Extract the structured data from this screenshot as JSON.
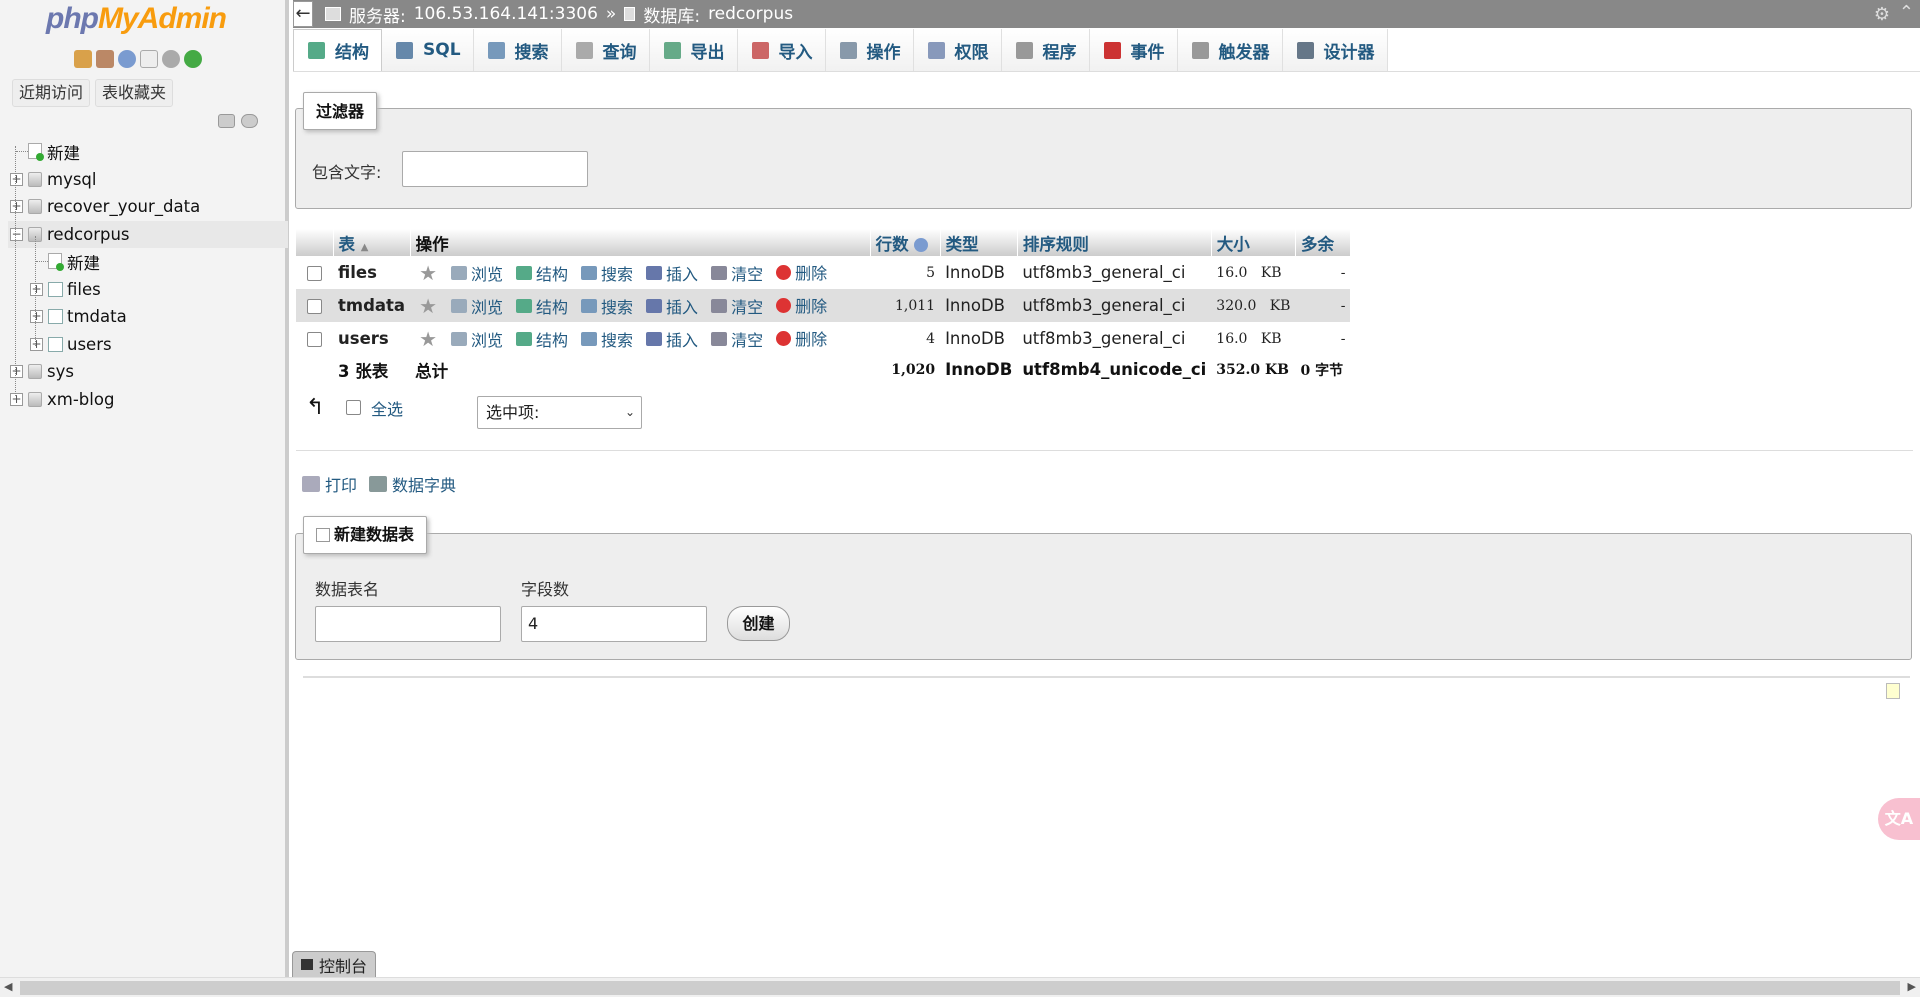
{
  "logo": {
    "part1": "php",
    "part2": "MyAdmin"
  },
  "sidebar": {
    "recent_tabs": [
      "近期访问",
      "表收藏夹"
    ],
    "tree": [
      {
        "label": "新建",
        "type": "new",
        "level": 0
      },
      {
        "label": "mysql",
        "type": "db",
        "level": 0
      },
      {
        "label": "recover_your_data",
        "type": "db",
        "level": 0
      },
      {
        "label": "redcorpus",
        "type": "db",
        "level": 0,
        "expanded": true
      },
      {
        "label": "新建",
        "type": "new",
        "level": 1
      },
      {
        "label": "files",
        "type": "table",
        "level": 1
      },
      {
        "label": "tmdata",
        "type": "table",
        "level": 1
      },
      {
        "label": "users",
        "type": "table",
        "level": 1
      },
      {
        "label": "sys",
        "type": "db",
        "level": 0
      },
      {
        "label": "xm-blog",
        "type": "db",
        "level": 0
      }
    ]
  },
  "topbar": {
    "server_label": "服务器:",
    "server": "106.53.164.141:3306",
    "sep": "»",
    "db_label": "数据库:",
    "db": "redcorpus"
  },
  "tabs": [
    {
      "label": "结构",
      "icon": "structure-icon",
      "color": "#5a8"
    },
    {
      "label": "SQL",
      "icon": "sql-icon",
      "color": "#68a"
    },
    {
      "label": "搜索",
      "icon": "search-icon",
      "color": "#79b"
    },
    {
      "label": "查询",
      "icon": "query-icon",
      "color": "#aaa"
    },
    {
      "label": "导出",
      "icon": "export-icon",
      "color": "#6a8"
    },
    {
      "label": "导入",
      "icon": "import-icon",
      "color": "#c66"
    },
    {
      "label": "操作",
      "icon": "wrench-icon",
      "color": "#89a"
    },
    {
      "label": "权限",
      "icon": "privileges-icon",
      "color": "#89b"
    },
    {
      "label": "程序",
      "icon": "routines-icon",
      "color": "#999"
    },
    {
      "label": "事件",
      "icon": "events-icon",
      "color": "#c33"
    },
    {
      "label": "触发器",
      "icon": "triggers-icon",
      "color": "#999"
    },
    {
      "label": "设计器",
      "icon": "designer-icon",
      "color": "#678"
    }
  ],
  "filter": {
    "legend": "过滤器",
    "label": "包含文字:",
    "value": ""
  },
  "table": {
    "headers": {
      "table": "表",
      "action": "操作",
      "rows": "行数",
      "type": "类型",
      "collation": "排序规则",
      "size": "大小",
      "overhead": "多余"
    },
    "action_labels": {
      "browse": "浏览",
      "structure": "结构",
      "search": "搜索",
      "insert": "插入",
      "empty": "清空",
      "drop": "删除"
    },
    "rows": [
      {
        "name": "files",
        "rows": "5",
        "type": "InnoDB",
        "collation": "utf8mb3_general_ci",
        "size": "16.0",
        "unit": "KB",
        "overhead": "-"
      },
      {
        "name": "tmdata",
        "rows": "1,011",
        "type": "InnoDB",
        "collation": "utf8mb3_general_ci",
        "size": "320.0",
        "unit": "KB",
        "overhead": "-"
      },
      {
        "name": "users",
        "rows": "4",
        "type": "InnoDB",
        "collation": "utf8mb3_general_ci",
        "size": "16.0",
        "unit": "KB",
        "overhead": "-"
      }
    ],
    "footer": {
      "count": "3 张表",
      "label": "总计",
      "rows": "1,020",
      "type": "InnoDB",
      "collation": "utf8mb4_unicode_ci",
      "size": "352.0",
      "unit": "KB",
      "overhead": "0 字节"
    }
  },
  "with_selected": {
    "check_all": "全选",
    "dropdown": "选中项:"
  },
  "links": {
    "print": "打印",
    "dictionary": "数据字典"
  },
  "create": {
    "legend": "新建数据表",
    "name_label": "数据表名",
    "name_value": "",
    "cols_label": "字段数",
    "cols_value": "4",
    "button": "创建"
  },
  "console": {
    "label": "控制台"
  },
  "translate": {
    "label": "文A"
  }
}
